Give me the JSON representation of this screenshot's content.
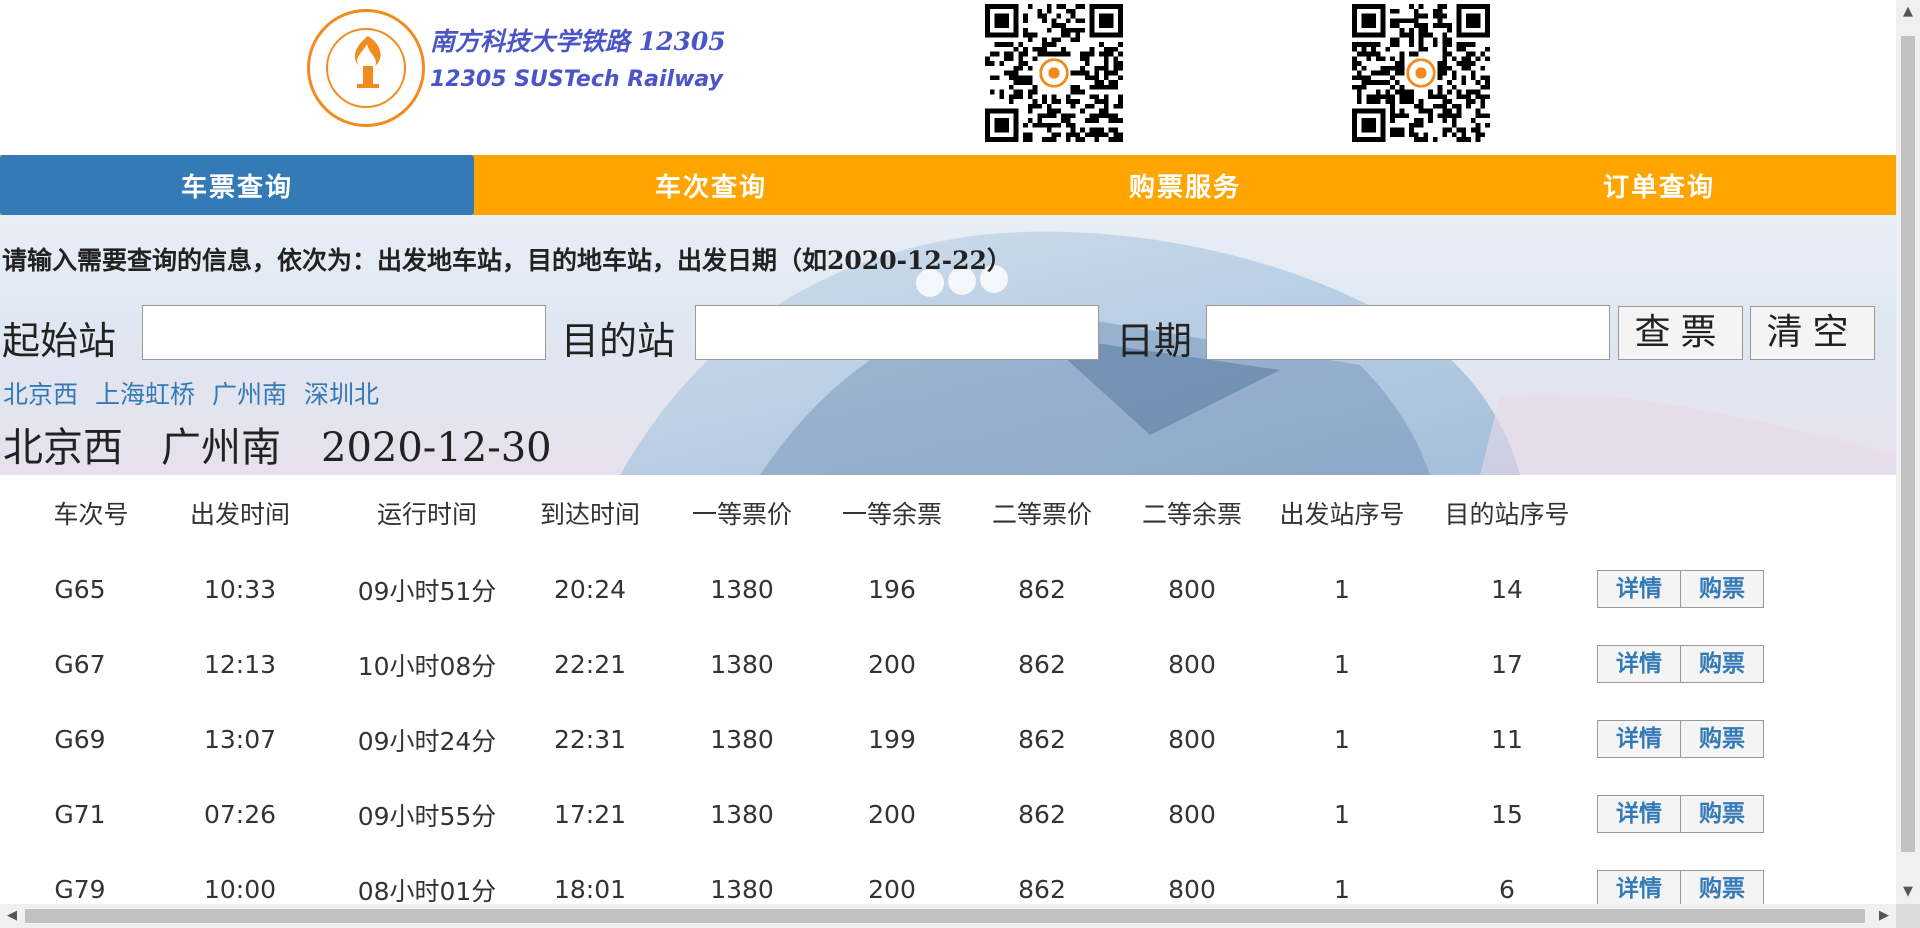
{
  "header": {
    "brand_cn": "南方科技大学铁路 12305",
    "brand_en": "12305 SUSTech Railway"
  },
  "nav": {
    "items": [
      {
        "label": "车票查询",
        "active": true
      },
      {
        "label": "车次查询",
        "active": false
      },
      {
        "label": "购票服务",
        "active": false
      },
      {
        "label": "订单查询",
        "active": false
      }
    ]
  },
  "search": {
    "instruction": "请输入需要查询的信息，依次为：出发地车站，目的地车站，出发日期（如2020-12-22）",
    "from_label": "起始站",
    "to_label": "目的站",
    "date_label": "日期",
    "from_value": "",
    "to_value": "",
    "date_value": "",
    "query_button": "查票",
    "clear_button": "清空",
    "quick_stations": [
      "北京西",
      "上海虹桥",
      "广州南",
      "深圳北"
    ],
    "selection": {
      "from": "北京西",
      "to": "广州南",
      "date": "2020-12-30"
    }
  },
  "table": {
    "headers": [
      "车次号",
      "出发时间",
      "运行时间",
      "到达时间",
      "一等票价",
      "一等余票",
      "二等票价",
      "二等余票",
      "出发站序号",
      "目的站序号"
    ],
    "detail_label": "详情",
    "buy_label": "购票",
    "rows": [
      [
        "G65",
        "10:33",
        "09小时51分",
        "20:24",
        "1380",
        "196",
        "862",
        "800",
        "1",
        "14"
      ],
      [
        "G67",
        "12:13",
        "10小时08分",
        "22:21",
        "1380",
        "200",
        "862",
        "800",
        "1",
        "17"
      ],
      [
        "G69",
        "13:07",
        "09小时24分",
        "22:31",
        "1380",
        "199",
        "862",
        "800",
        "1",
        "11"
      ],
      [
        "G71",
        "07:26",
        "09小时55分",
        "17:21",
        "1380",
        "200",
        "862",
        "800",
        "1",
        "15"
      ],
      [
        "G79",
        "10:00",
        "08小时01分",
        "18:01",
        "1380",
        "200",
        "862",
        "800",
        "1",
        "6"
      ]
    ]
  },
  "colors": {
    "nav_bg": "#ffa500",
    "nav_active": "#337ab7",
    "brand": "#4a55c8",
    "link": "#337ab7",
    "logo": "#f28b1e"
  },
  "icons": {
    "logo": "sustech-logo",
    "qr1": "qr-code",
    "qr2": "qr-code"
  }
}
